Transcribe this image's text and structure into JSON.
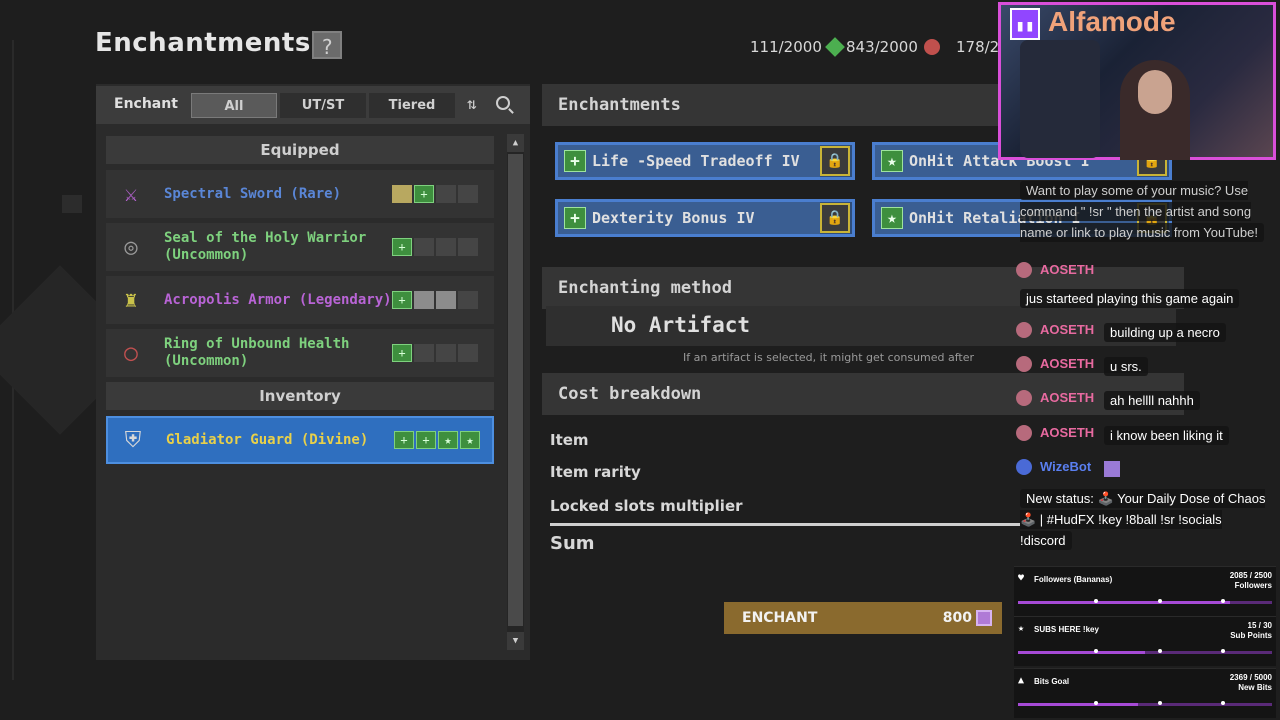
{
  "header": {
    "title": "Enchantments",
    "help": "?",
    "resources": [
      {
        "value": "111/2000",
        "icon": "green-gem-icon"
      },
      {
        "value": "843/2000",
        "icon": "red-orb-icon"
      },
      {
        "value": "178/2"
      }
    ]
  },
  "filter": {
    "label": "Enchant",
    "tabs": [
      "All",
      "UT/ST",
      "Tiered"
    ],
    "active_tab": "All",
    "sort_glyph": "⇅"
  },
  "list": {
    "equipped_heading": "Equipped",
    "inventory_heading": "Inventory",
    "equipped": [
      {
        "name": "Spectral Sword (Rare)",
        "color": "#5a86d6",
        "icon": "⚔"
      },
      {
        "name": "Seal of the Holy Warrior (Uncommon)",
        "color": "#7ed17e",
        "icon": "◎"
      },
      {
        "name": "Acropolis Armor (Legendary)",
        "color": "#b964d6",
        "icon": "♜"
      },
      {
        "name": "Ring of Unbound Health (Uncommon)",
        "color": "#7ed17e",
        "icon": "◯"
      }
    ],
    "inventory": [
      {
        "name": "Gladiator Guard (Divine)",
        "color": "#e8d04a",
        "icon": "⛨"
      }
    ]
  },
  "enchantments": {
    "heading": "Enchantments",
    "slots": [
      {
        "label": "Life -Speed Tradeoff IV"
      },
      {
        "label": "OnHit Attack Boost I"
      },
      {
        "label": "Dexterity Bonus IV"
      },
      {
        "label": "OnHit Retaliation I"
      }
    ]
  },
  "method": {
    "heading": "Enchanting method",
    "value": "No Artifact",
    "hint": "If an artifact is selected, it might get consumed after"
  },
  "cost": {
    "heading": "Cost breakdown",
    "rows": [
      "Item",
      "Item rarity",
      "Locked slots multiplier"
    ],
    "sum_label": "Sum"
  },
  "action": {
    "label": "ENCHANT",
    "cost": "800"
  },
  "stream": {
    "name": "Alfamode",
    "chat": {
      "bot_intro": "Want to play some of your music? Use command \" !sr \" then the artist and song name or link to play music from YouTube!",
      "messages": [
        {
          "user": "AOSETH",
          "text": "jus starteed playing this game again"
        },
        {
          "user": "AOSETH",
          "text": "building up a necro"
        },
        {
          "user": "AOSETH",
          "text": "u srs."
        },
        {
          "user": "AOSETH",
          "text": "ah hellll nahhh"
        },
        {
          "user": "AOSETH",
          "text": "i know been liking it"
        }
      ],
      "bot_name": "WizeBot",
      "status_text": "New status: 🕹️ Your Daily Dose of Chaos🕹️ | #HudFX !key !8ball !sr !socials !discord"
    },
    "goals": [
      {
        "label": "Followers (Bananas)",
        "count": "2085 / 2500",
        "sub": "Followers",
        "fraction": 0.834
      },
      {
        "label": "SUBS HERE !key",
        "count": "15 / 30",
        "sub": "Sub Points",
        "fraction": 0.5
      },
      {
        "label": "Bits Goal",
        "count": "2369 / 5000",
        "sub": "New Bits",
        "fraction": 0.474
      }
    ]
  }
}
